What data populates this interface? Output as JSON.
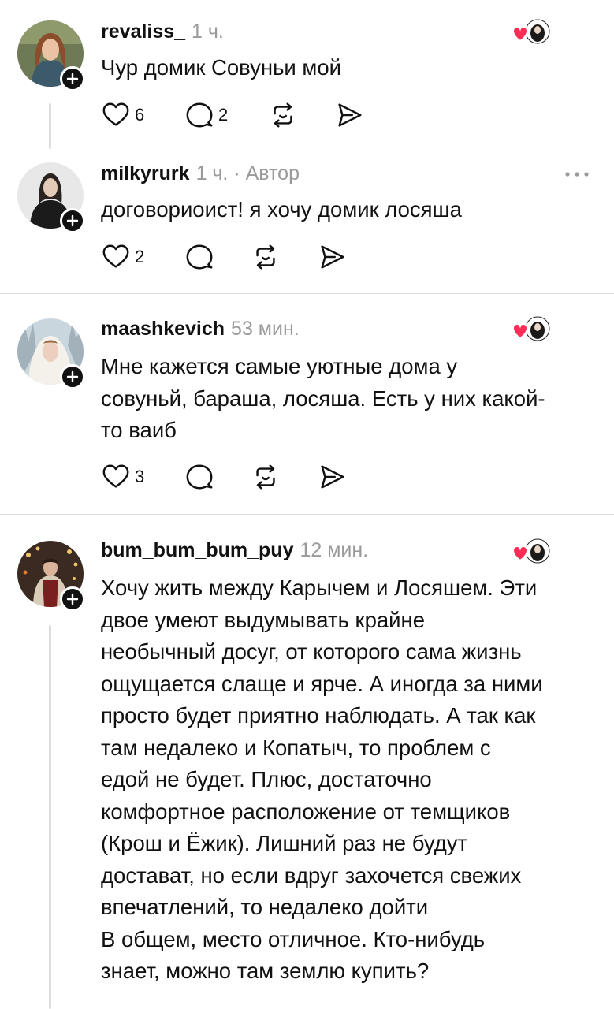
{
  "posts": [
    {
      "username": "revaliss_",
      "time": "1 ч.",
      "text": [
        "Чур домик Совуньи мой"
      ],
      "likes": "6",
      "replies": "2"
    },
    {
      "username": "milkyrurk",
      "time": "1 ч. · Автор",
      "text": [
        "договориоист! я хочу домик лосяша"
      ],
      "likes": "2",
      "replies": ""
    },
    {
      "username": "maashkevich",
      "time": "53 мин.",
      "text": [
        "Мне кажется самые уютные дома у",
        "совуньй, бараша, лосяша. Есть у них какой-",
        "то ваиб"
      ],
      "likes": "3",
      "replies": ""
    },
    {
      "username": "bum_bum_bum_puy",
      "time": "12 мин.",
      "text": [
        "Хочу жить между Карычем и Лосяшем. Эти",
        "двое умеют выдумывать крайне",
        "необычный досуг, от которого сама жизнь",
        "ощущается слаще и ярче. А иногда за ними",
        "просто будет приятно наблюдать. А так как",
        "там недалеко и Копатыч, то проблем с",
        "едой не будет. Плюс, достаточно",
        "комфортное расположение от темщиков",
        "(Крош и Ёжик). Лишний раз не будут",
        "достават, но если вдруг захочется свежих",
        "впечатлений, то недалеко дойти",
        "В общем, место отличное. Кто-нибудь",
        "знает, можно там землю купить?"
      ],
      "likes": "",
      "replies": ""
    }
  ],
  "icons": {
    "like": "heart-icon",
    "reply": "comment-icon",
    "repost": "repost-icon",
    "share": "share-icon",
    "follow": "plus-icon",
    "more": "more-icon"
  },
  "colors": {
    "accent_heart": "#ff2d55",
    "muted": "#9a9a9a"
  }
}
